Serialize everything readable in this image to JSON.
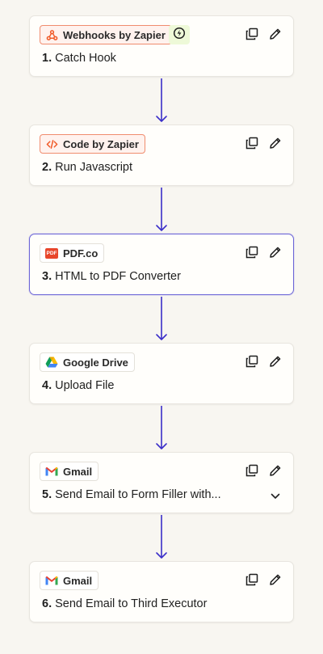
{
  "steps": [
    {
      "number": "1.",
      "title": "Catch Hook",
      "app": "Webhooks by Zapier",
      "app_icon": "webhook-icon",
      "trigger_icon": "bolt-icon"
    },
    {
      "number": "2.",
      "title": "Run Javascript",
      "app": "Code by Zapier",
      "app_icon": "code-icon"
    },
    {
      "number": "3.",
      "title": "HTML to PDF Converter",
      "app": "PDF.co",
      "app_icon": "pdfco-icon",
      "selected": true
    },
    {
      "number": "4.",
      "title": "Upload File",
      "app": "Google Drive",
      "app_icon": "google-drive-icon"
    },
    {
      "number": "5.",
      "title": "Send Email to Form Filler with...",
      "app": "Gmail",
      "app_icon": "gmail-icon",
      "expand_icon": "chevron-down-icon"
    },
    {
      "number": "6.",
      "title": "Send Email to Third Executor",
      "app": "Gmail",
      "app_icon": "gmail-icon"
    }
  ],
  "pdfco_logo_text": "PDF",
  "colors": {
    "background": "#f8f6f1",
    "zapier_orange": "#f05a28",
    "connector": "#3b2fc9",
    "selected_border": "#6e67d8"
  }
}
